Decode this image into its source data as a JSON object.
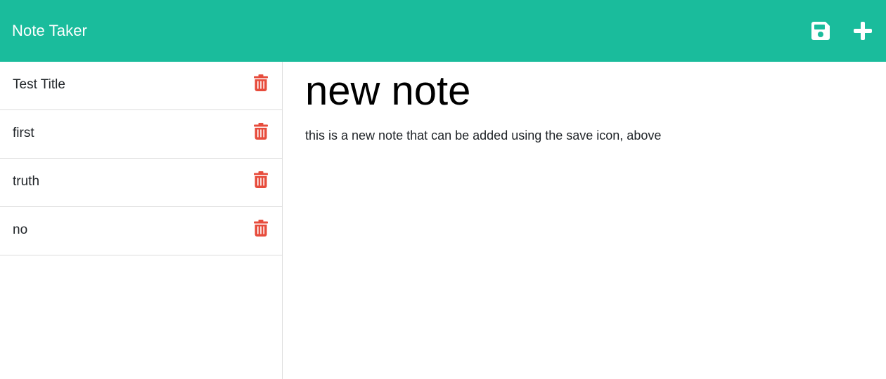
{
  "navbar": {
    "brand": "Note Taker",
    "accent_color": "#1abc9c",
    "icons": [
      "save-icon",
      "plus-icon"
    ]
  },
  "sidebar": {
    "items": [
      {
        "title": "Test Title",
        "icon": "trash-icon"
      },
      {
        "title": "first",
        "icon": "trash-icon"
      },
      {
        "title": "truth",
        "icon": "trash-icon"
      },
      {
        "title": "no",
        "icon": "trash-icon"
      }
    ],
    "delete_color": "#e74c3c"
  },
  "note": {
    "title": "new note",
    "text": "this is a new note that can be added using the save icon, above"
  }
}
